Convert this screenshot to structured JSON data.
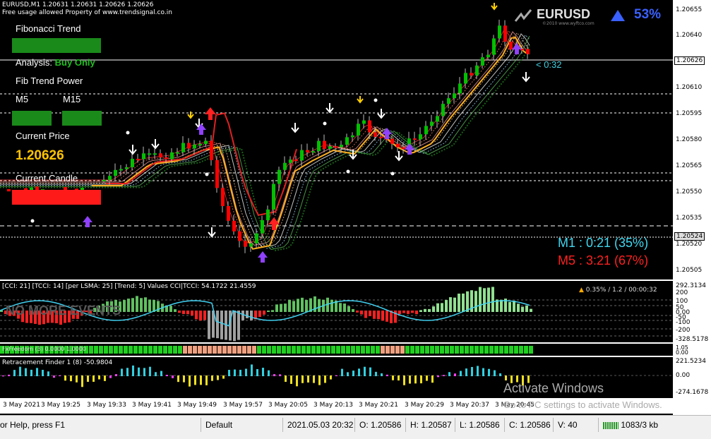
{
  "header": {
    "symbol_line": "EURUSD,M1  1.20631 1.20631 1.20626 1.20626",
    "usage_line": "Free usage allowed Property of www.trendsignal.co.in"
  },
  "badge": {
    "symbol": "EURUSD",
    "percent": "53%",
    "arrow_icon": "up-triangle-icon",
    "subtext": "©2010 www.wyftco.com"
  },
  "info_panel": {
    "fib_trend_label": "Fibonacci Trend",
    "analysis_label": "Analysis:",
    "analysis_value": "Buy Only",
    "fib_power_label": "Fib Trend Power",
    "m5_label": "M5",
    "m15_label": "M15",
    "current_price_label": "Current Price",
    "current_price_value": "1.20626",
    "current_candle_label": "Current Candle"
  },
  "countdown": "< 0:32",
  "timers": {
    "m1": "M1 : 0:21 (35%)",
    "m5": "M5 : 3:21 (67%)"
  },
  "price_axis": {
    "labels": [
      "1.20655",
      "1.20640",
      "1.20610",
      "1.20595",
      "1.20580",
      "1.20565",
      "1.20550",
      "1.20535",
      "1.20520",
      "1.20505"
    ],
    "current_box": "1.20626",
    "marker_box": "1.20524"
  },
  "cci_panel": {
    "title": "[CCI: 21] [TCCI: 14] [per LSMA: 25] [Trend: 5] Values CCI|TCCI: 54.1722 21.4559",
    "overlay": "NO MORE EVENTS",
    "status": "0.35% / 1.2 / 00:00:32",
    "axis": [
      "292.3134",
      "200",
      "100",
      "50",
      "0.00",
      "-50",
      "-100",
      "-200",
      "-328.5178"
    ]
  },
  "strip_panel": {
    "title": "FxFreedom (3) 0.0000 1.0000",
    "axis": [
      "1.05",
      "0.00"
    ]
  },
  "retracement_panel": {
    "title": "Retracement Finder 1 (8) -50.9804",
    "axis": [
      "221.5234",
      "0.00",
      "-274.1678"
    ]
  },
  "time_axis": [
    "3 May 2021",
    "3 May 19:25",
    "3 May 19:33",
    "3 May 19:41",
    "3 May 19:49",
    "3 May 19:57",
    "3 May 20:05",
    "3 May 20:13",
    "3 May 20:21",
    "3 May 20:29",
    "3 May 20:37",
    "3 May 20:45"
  ],
  "watermark": {
    "line1": "Activate Windows",
    "line2": "Go to PC settings to activate Windows."
  },
  "status_bar": {
    "help": "or Help, press F1",
    "profile": "Default",
    "datetime": "2021.05.03 20:32",
    "open": "O: 1.20586",
    "high": "H: 1.20587",
    "low": "L: 1.20586",
    "close": "C: 1.20586",
    "volume": "V: 40",
    "traffic": "1083/3 kb"
  },
  "colors": {
    "bull": "#00c000",
    "bear": "#ff0000",
    "accent_yellow": "#ffd700",
    "cyan": "#40e0e0",
    "blue_badge": "#3050e0"
  }
}
